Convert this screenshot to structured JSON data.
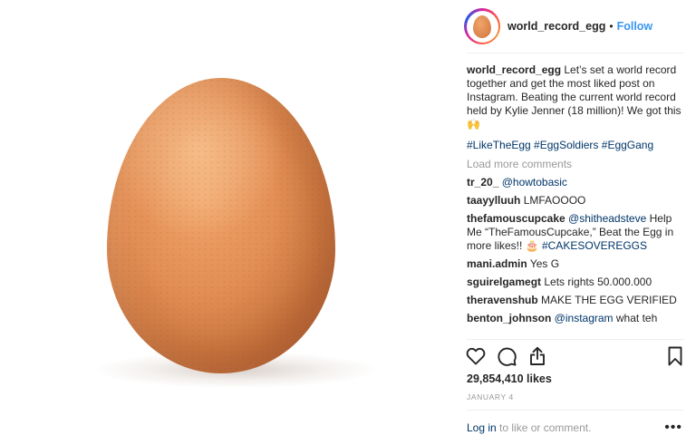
{
  "post": {
    "username": "world_record_egg",
    "follow_label": "Follow",
    "separator": "•"
  },
  "caption": {
    "username": "world_record_egg",
    "text": "Let’s set a world record together and get the most liked post on Instagram. Beating the current world record held by Kylie Jenner (18 million)! We got this 🙌",
    "hashtags": "#LikeTheEgg #EggSoldiers #EggGang"
  },
  "load_more": "Load more comments",
  "comments": [
    {
      "username": "tr_20_",
      "text": "",
      "mention": "@howtobasic",
      "tail": ""
    },
    {
      "username": "taayylluuh",
      "text": "LMFAOOOO",
      "mention": "",
      "tail": ""
    },
    {
      "username": "thefamouscupcake",
      "text": "",
      "mention": "@shitheadsteve",
      "tail": " Help Me “TheFamousCupcake,” Beat the Egg in more likes!! 🎂 ",
      "tag": "#CAKESOVEREGGS"
    },
    {
      "username": "mani.admin",
      "text": "Yes G",
      "mention": "",
      "tail": ""
    },
    {
      "username": "sguirelgamegt",
      "text": "Lets rights 50.000.000",
      "mention": "",
      "tail": ""
    },
    {
      "username": "theravenshub",
      "text": "MAKE THE EGG VERIFIED",
      "mention": "",
      "tail": ""
    },
    {
      "username": "benton_johnson",
      "text": "",
      "mention": "@instagram",
      "tail": " what teh"
    }
  ],
  "likes": "29,854,410 likes",
  "date": "JANUARY 4",
  "footer": {
    "login_label": "Log in",
    "login_suffix": " to like or comment.",
    "more_label": "•••"
  },
  "icons": {
    "like": "heart-icon",
    "comment": "comment-bubble-icon",
    "share": "share-icon",
    "save": "bookmark-icon"
  },
  "colors": {
    "link": "#003569",
    "follow": "#3897f0",
    "muted": "#999999",
    "text": "#262626"
  }
}
